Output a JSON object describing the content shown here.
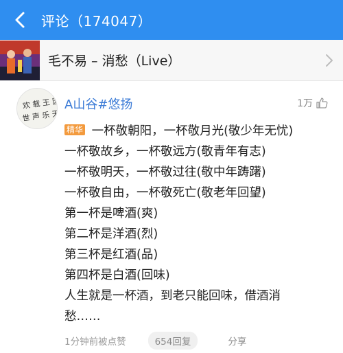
{
  "header": {
    "title": "评论（174047）",
    "back_icon": "chevron-left-icon",
    "bg": "#2f8ef0"
  },
  "song": {
    "title": "毛不易  –  消愁（Live）"
  },
  "comment": {
    "username": "A山谷#悠扬",
    "like_count": "1万",
    "badge": "精华",
    "lines": [
      "一杯敬朝阳，一杯敬月光(敬少年无忧)",
      "一杯敬故乡，一杯敬远方(敬青年有志)",
      "一杯敬明天，一杯敬过往(敬中年踌躇)",
      "一杯敬自由，一杯敬死亡(敬老年回望)",
      "第一杯是啤酒(爽)",
      "第二杯是洋酒(烈)",
      "第三杯是红酒(品)",
      "第四杯是白酒(回味)",
      "人生就是一杯酒，到老只能回味，借酒消",
      "愁……"
    ],
    "time": "1分钟前被点赞",
    "reply": "654回复",
    "share": "分享",
    "avatar_text": [
      "欢",
      "载",
      "王",
      "因",
      "世",
      "声",
      "乐",
      "天"
    ]
  }
}
